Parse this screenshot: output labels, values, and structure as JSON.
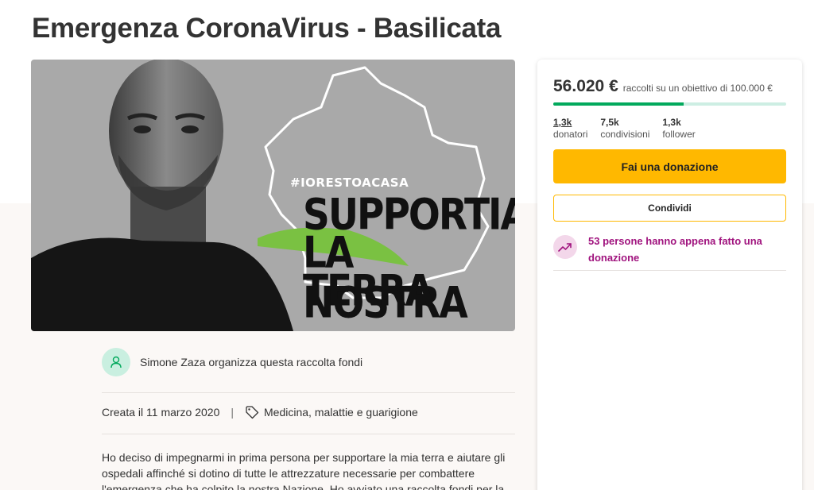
{
  "page": {
    "title": "Emergenza CoronaVirus - Basilicata"
  },
  "hero": {
    "hashtag": "#IORESTOACASA",
    "line1": "SUPPORTIAMO",
    "line2": "LA NOSTRA",
    "line3": "TERRA",
    "accent_color": "#7ac142"
  },
  "organizer": {
    "text": "Simone Zaza organizza questa raccolta fondi",
    "icon": "user-heart-icon"
  },
  "meta": {
    "created": "Creata il 11 marzo 2020",
    "separator": "|",
    "category": "Medicina, malattie e guarigione",
    "category_icon": "tag-icon"
  },
  "description": {
    "text": "Ho deciso di impegnarmi in prima persona per supportare la mia terra e aiutare gli ospedali affinché si dotino di tutte le attrezzature necessarie per combattere l'emergenza che ha colpito la nostra Nazione. Ho avviato una raccolta fondi per la"
  },
  "campaign": {
    "raised": "56.020 €",
    "goal_text": "raccolti su un obiettivo di 100.000 €",
    "progress": 0.56,
    "colors": {
      "progress_fill": "#02a95c",
      "progress_track": "#cdeee3",
      "donate": "#ffb800",
      "recent": "#a0137e"
    },
    "stats": [
      {
        "value": "1,3k",
        "label": "donatori"
      },
      {
        "value": "7,5k",
        "label": "condivisioni"
      },
      {
        "value": "1,3k",
        "label": "follower"
      }
    ],
    "donate_label": "Fai una donazione",
    "share_label": "Condividi",
    "recent_text": "53 persone hanno appena fatto una donazione",
    "recent_icon": "trending-up-icon"
  }
}
